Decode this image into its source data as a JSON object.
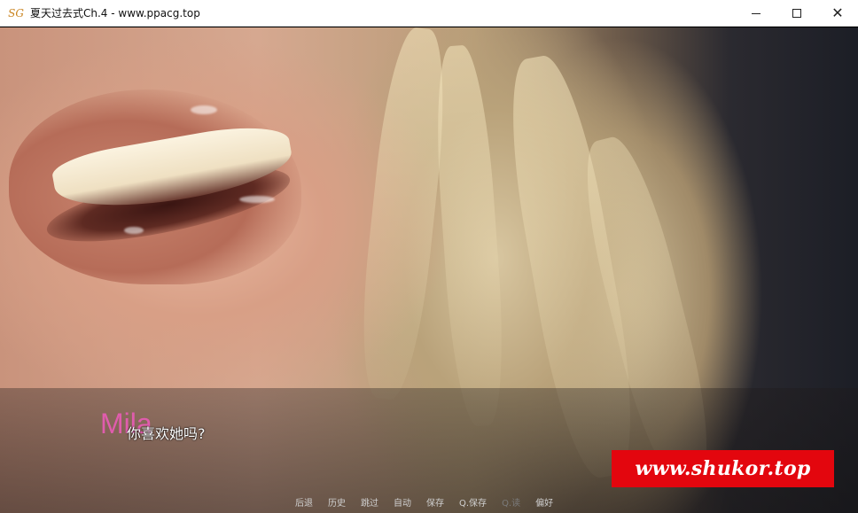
{
  "window": {
    "logo_text": "SG",
    "title": "夏天过去式Ch.4 - www.ppacg.top",
    "close_glyph": "✕"
  },
  "dialogue": {
    "speaker": "Mila",
    "speaker_color": "#e05cad",
    "text": "你喜欢她吗?"
  },
  "quick_menu": {
    "items": [
      "后退",
      "历史",
      "跳过",
      "自动",
      "保存",
      "Q.保存",
      "Q.读",
      "偏好"
    ]
  },
  "watermark": {
    "text": "www.shukor.top",
    "color": "#e3060e"
  }
}
